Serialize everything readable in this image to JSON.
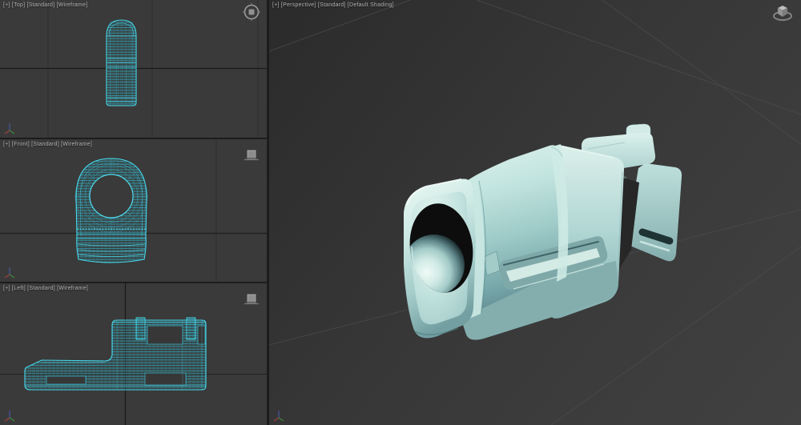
{
  "viewports": {
    "top": {
      "label": "[+] [Top] [Standard] [Wireframe]"
    },
    "front": {
      "label": "[+] [Front] [Standard] [Wireframe]"
    },
    "left": {
      "label": "[+] [Left] [Standard] [Wireframe]"
    },
    "perspective": {
      "label": "[+] [Perspective] [Standard] [Default Shading]"
    }
  },
  "icons": {
    "top_right_of_each_viewport": "viewcube-icon",
    "bottom_left_of_each_viewport": "world-axis-tripod-icon"
  },
  "colors": {
    "viewport_background": "#3a3a3a",
    "wireframe_model": "#46d9ec",
    "shaded_model_base": "#b6dcd8",
    "shaded_model_highlight": "#ecf9f4",
    "shaded_model_shadow": "#628f94",
    "ortho_grid_line": "#2d2d2d",
    "ortho_axis_line": "#1a1a1a",
    "perspective_grid_line": "#4c4c4c",
    "active_viewport_border": "#867946",
    "label_text": "#b2b2b2"
  }
}
